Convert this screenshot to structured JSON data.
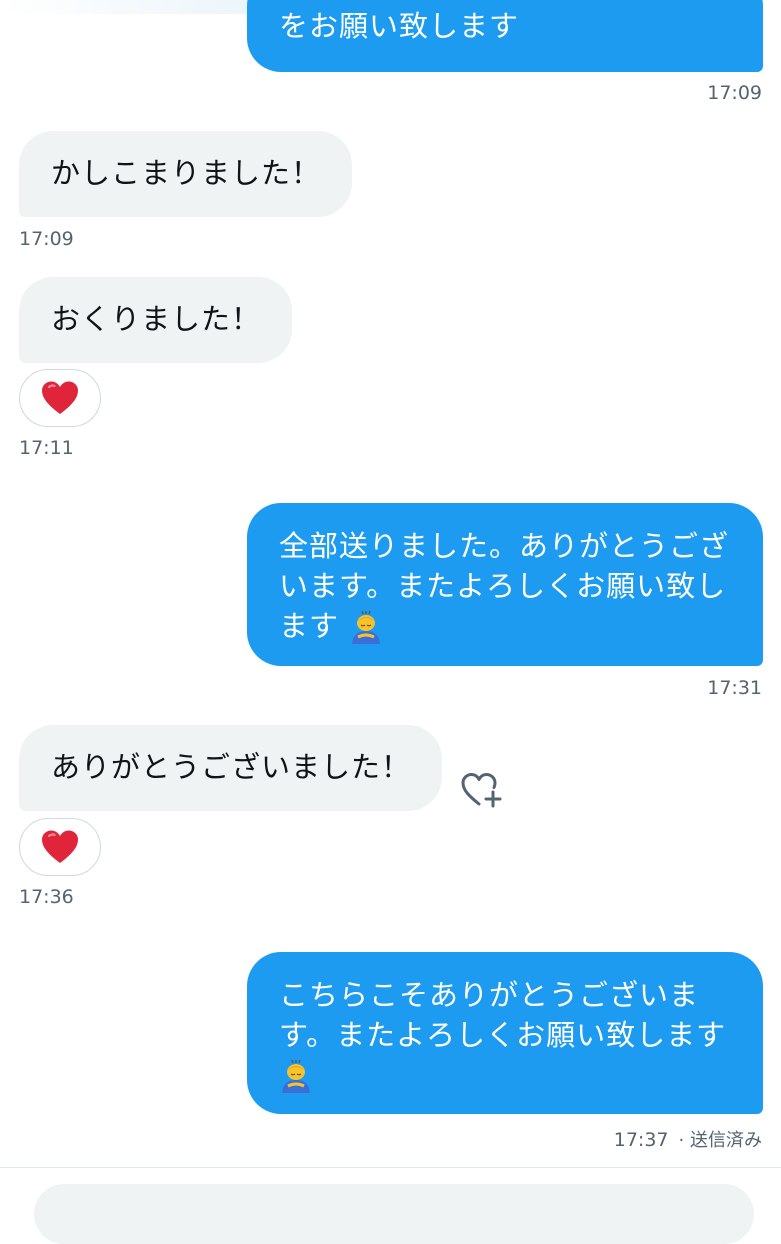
{
  "messages": [
    {
      "id": "m1",
      "dir": "out",
      "text": "をお願い致します",
      "time": "17:09"
    },
    {
      "id": "m2",
      "dir": "in",
      "text": "かしこまりました！",
      "time": "17:09"
    },
    {
      "id": "m3",
      "dir": "in",
      "text": "おくりました！",
      "time": "17:11",
      "reaction": "heart-emoji"
    },
    {
      "id": "m4",
      "dir": "out",
      "lines": [
        "全部送りました。ありがとうござ",
        "います。またよろしくお願い致し",
        "ます"
      ],
      "emoji": "person-bowing-emoji",
      "time": "17:31"
    },
    {
      "id": "m5",
      "dir": "in",
      "text": "ありがとうございました！",
      "time": "17:36",
      "reaction": "heart-emoji"
    },
    {
      "id": "m6",
      "dir": "out",
      "lines": [
        "こちらこそありがとうございま",
        "す。またよろしくお願い致します"
      ],
      "emoji": "person-bowing-emoji",
      "time": "17:37",
      "status": "· 送信済み"
    }
  ],
  "colors": {
    "outgoing_bubble": "#1d9bf0",
    "incoming_bubble": "#eff3f4",
    "timestamp": "#536471",
    "heart": "#e0243a"
  },
  "icons": {
    "add_reaction": "heart-plus-icon"
  }
}
